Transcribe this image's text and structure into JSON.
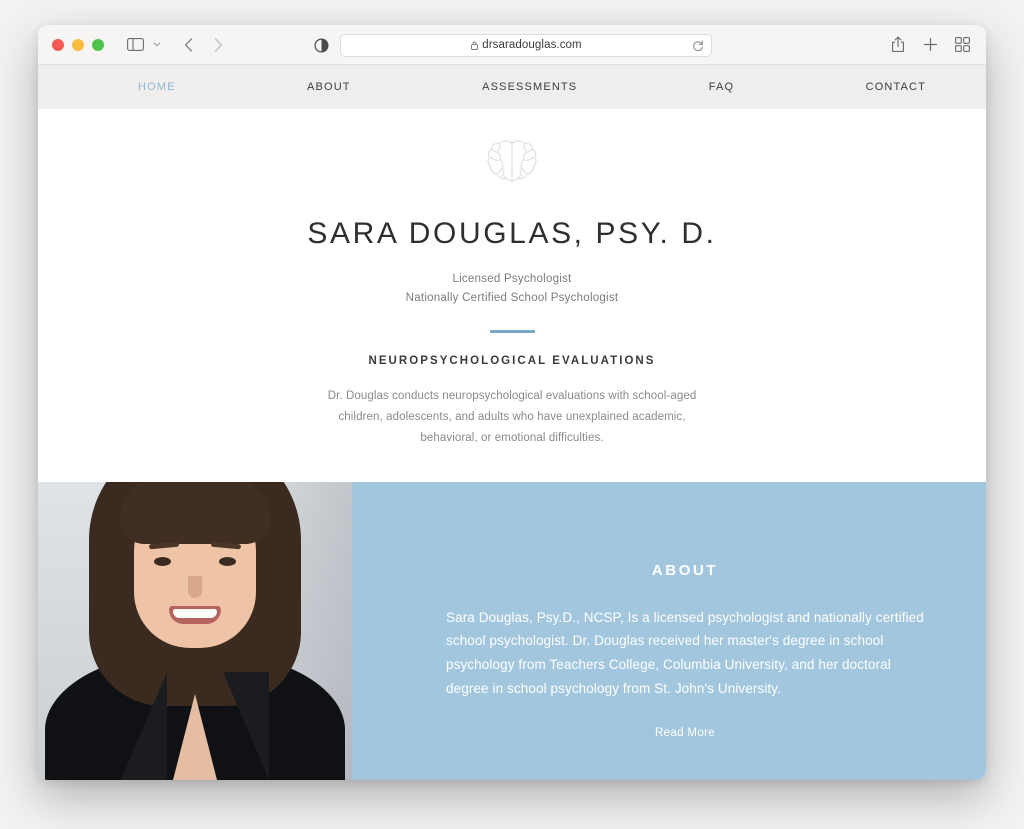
{
  "browser": {
    "name": "Safari",
    "traffic_lights": [
      "close",
      "minimize",
      "zoom"
    ],
    "sidebar_label": "Show Sidebar",
    "tab_overview_label": "Tab Overview",
    "back_label": "Back",
    "forward_label": "Forward",
    "share_label": "Share",
    "new_tab_label": "New Tab",
    "privacy_label": "Privacy Report",
    "reload_label": "Reload",
    "url": "drsaradouglas.com",
    "secure": true
  },
  "site": {
    "nav": [
      {
        "label": "HOME",
        "active": true
      },
      {
        "label": "ABOUT",
        "active": false
      },
      {
        "label": "ASSESSMENTS",
        "active": false
      },
      {
        "label": "FAQ",
        "active": false
      },
      {
        "label": "CONTACT",
        "active": false
      }
    ],
    "hero": {
      "logo_icon": "brain-icon",
      "title": "SARA DOUGLAS, PSY. D.",
      "credential_line_1": "Licensed Psychologist",
      "credential_line_2": "Nationally Certified School Psychologist",
      "section_heading": "NEUROPSYCHOLOGICAL EVALUATIONS",
      "body": "Dr. Douglas conducts neuropsychological evaluations with school-aged children, adolescents, and adults who have unexplained academic, behavioral, or emotional difficulties."
    },
    "about": {
      "title": "ABOUT",
      "text": "Sara Douglas, Psy.D., NCSP, Is a licensed psychologist and nationally certified school psychologist. Dr. Douglas received her master's degree in school psychology from Teachers College, Columbia University, and her doctoral degree in school psychology from St. John's University.",
      "read_more_label": "Read More",
      "photo_alt": "Portrait of Sara Douglas"
    }
  },
  "colors": {
    "accent_blue": "#a2c6dd",
    "rule_blue": "#7ba7c4",
    "active_nav": "#8fb8d4",
    "nav_bar_bg": "#f0eeec",
    "toolbar_bg": "#f6f5f4",
    "page_bg": "#ffffff",
    "desktop_bg": "#f2f2f2"
  }
}
